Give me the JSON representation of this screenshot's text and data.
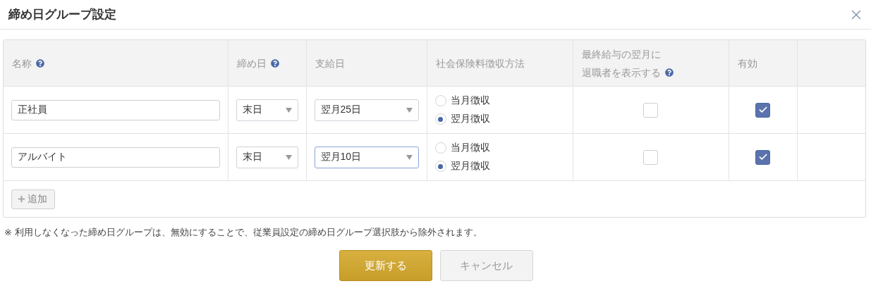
{
  "dialog": {
    "title": "締め日グループ設定"
  },
  "table": {
    "columns": [
      {
        "label": "名称",
        "help": true
      },
      {
        "label": "締め日",
        "help": true
      },
      {
        "label": "支給日",
        "help": false
      },
      {
        "label": "社会保険料徴収方法",
        "help": false
      },
      {
        "label": "最終給与の翌月に",
        "label_line_2": "退職者を表示する",
        "help": true
      },
      {
        "label": "有効",
        "help": false
      }
    ],
    "rows": [
      {
        "name": "正社員",
        "closing_day": "末日",
        "pay_day": {
          "value": "翌月25日",
          "focused": false
        },
        "collection": [
          {
            "label": "当月徴収",
            "selected": false
          },
          {
            "label": "翌月徴収",
            "selected": true
          }
        ],
        "show_retired": {
          "checked": false
        },
        "enabled": {
          "checked": true
        }
      },
      {
        "name": "アルバイト",
        "closing_day": "末日",
        "pay_day": {
          "value": "翌月10日",
          "focused": true
        },
        "collection": [
          {
            "label": "当月徴収",
            "selected": false
          },
          {
            "label": "翌月徴収",
            "selected": true
          }
        ],
        "show_retired": {
          "checked": false
        },
        "enabled": {
          "checked": true
        }
      }
    ],
    "add_button": "追加"
  },
  "note": "※ 利用しなくなった締め日グループは、無効にすることで、従業員設定の締め日グループ選択肢から除外されます。",
  "buttons": [
    {
      "label": "更新する",
      "kind": "primary"
    },
    {
      "label": "キャンセル",
      "kind": "secondary"
    }
  ]
}
